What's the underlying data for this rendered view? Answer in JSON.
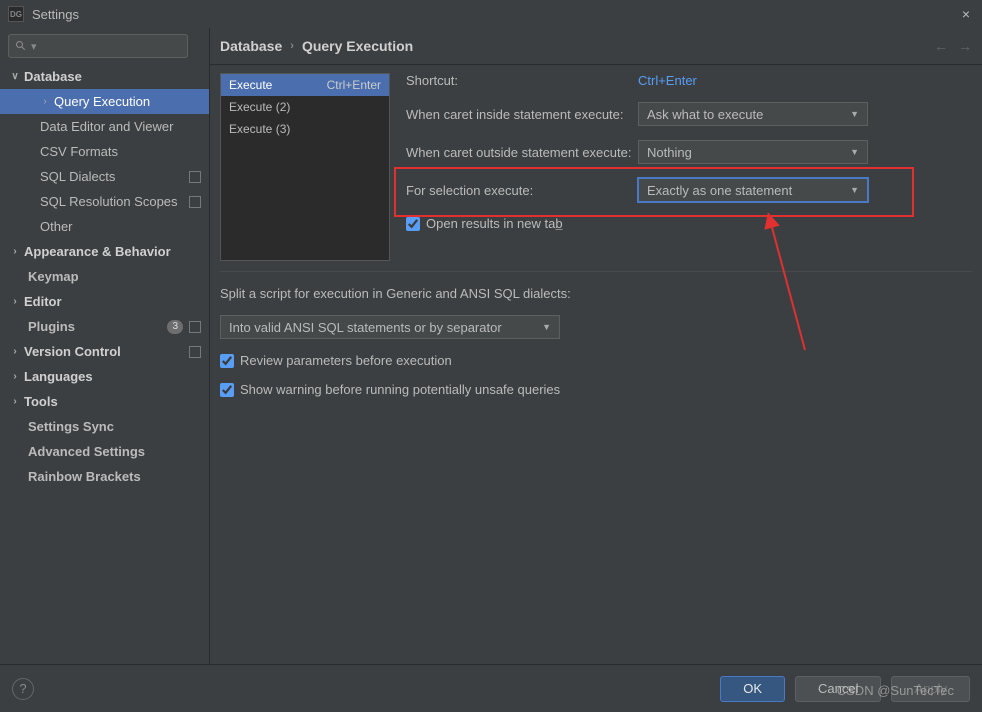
{
  "titlebar": {
    "app_icon": "DG",
    "title": "Settings",
    "close": "×"
  },
  "search": {
    "placeholder": ""
  },
  "sidebar": {
    "items": [
      {
        "label": "Database",
        "chev": "∨"
      },
      {
        "label": "Query Execution"
      },
      {
        "label": "Data Editor and Viewer"
      },
      {
        "label": "CSV Formats"
      },
      {
        "label": "SQL Dialects"
      },
      {
        "label": "SQL Resolution Scopes"
      },
      {
        "label": "Other"
      },
      {
        "label": "Appearance & Behavior",
        "chev": "›"
      },
      {
        "label": "Keymap"
      },
      {
        "label": "Editor",
        "chev": "›"
      },
      {
        "label": "Plugins",
        "badge": "3"
      },
      {
        "label": "Version Control",
        "chev": "›"
      },
      {
        "label": "Languages",
        "chev": "›"
      },
      {
        "label": "Tools",
        "chev": "›"
      },
      {
        "label": "Settings Sync"
      },
      {
        "label": "Advanced Settings"
      },
      {
        "label": "Rainbow Brackets"
      }
    ]
  },
  "breadcrumb": {
    "root": "Database",
    "sep": "›",
    "leaf": "Query Execution",
    "back": "←",
    "fwd": "→"
  },
  "exec_list": [
    {
      "label": "Execute",
      "shortcut": "Ctrl+Enter"
    },
    {
      "label": "Execute (2)"
    },
    {
      "label": "Execute (3)"
    }
  ],
  "form": {
    "shortcut_label": "Shortcut:",
    "shortcut_value": "Ctrl+Enter",
    "inside_label": "When caret inside statement execute:",
    "inside_value": "Ask what to execute",
    "outside_label": "When caret outside statement execute:",
    "outside_value": "Nothing",
    "selection_label": "For selection execute:",
    "selection_value": "Exactly as one statement",
    "open_results": "Open results in new ta",
    "open_results_u": "b"
  },
  "lower": {
    "split_label": "Split a script for execution in Generic and ANSI SQL dialects:",
    "split_value": "Into valid ANSI SQL statements or by separator",
    "review": "Review parameters before execution",
    "warning": "Show warning before running potentially unsafe queries"
  },
  "footer": {
    "help": "?",
    "ok": "OK",
    "cancel": "Cancel",
    "apply": "Apply"
  },
  "watermark": "CSDN @SunTecTec"
}
